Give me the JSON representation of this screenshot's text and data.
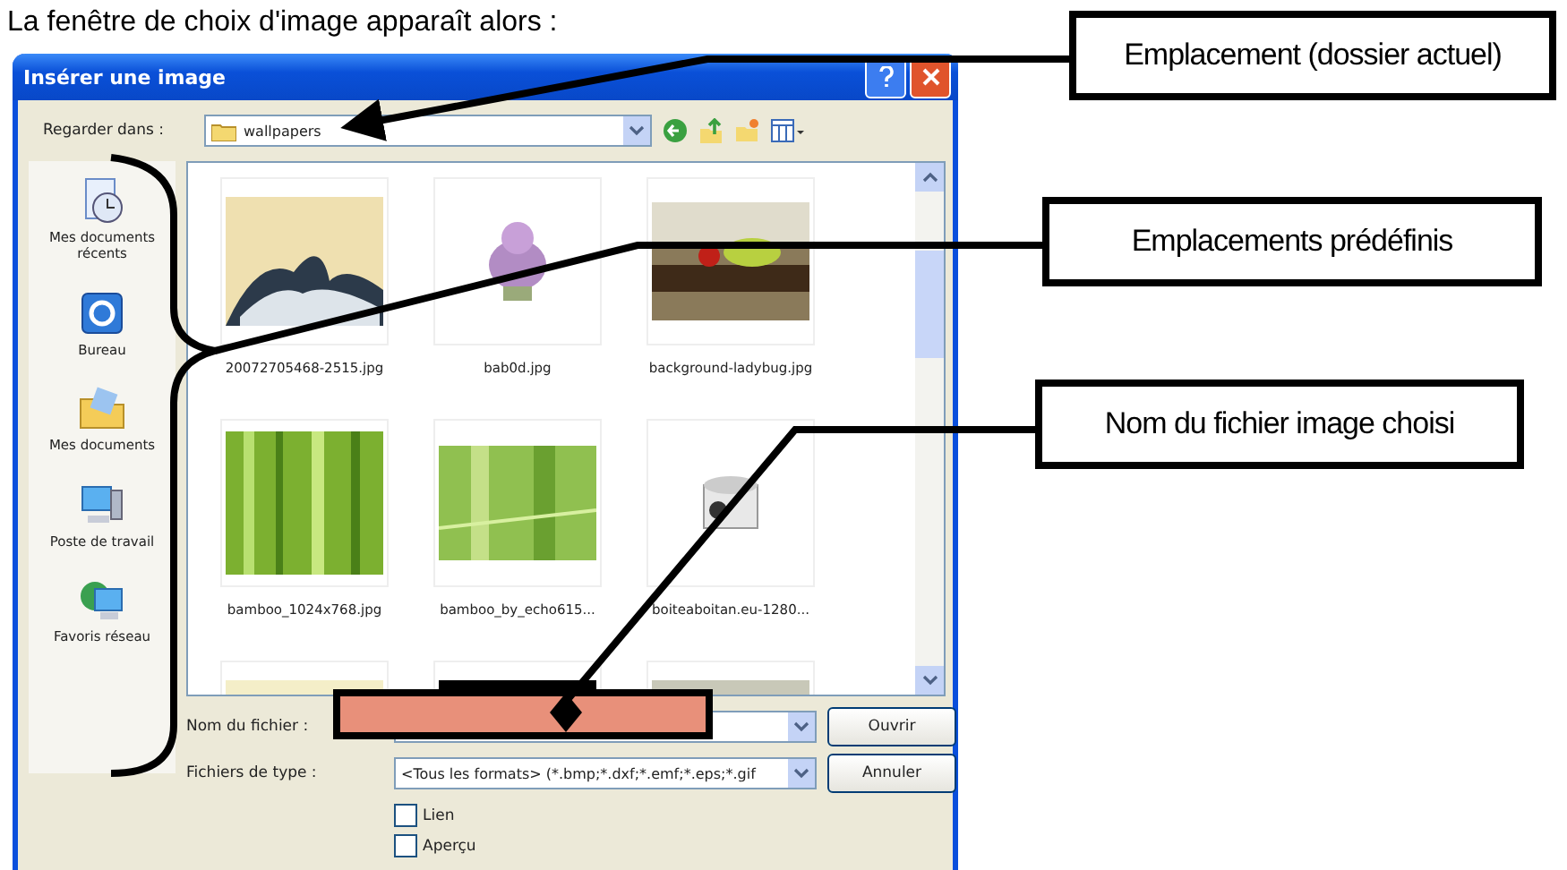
{
  "heading": "La fenêtre de choix d'image apparaît alors :",
  "dialog": {
    "title": "Insérer une image",
    "look_in": {
      "label": "Regarder dans :",
      "value": "wallpapers"
    },
    "places": [
      {
        "label": "Mes documents récents",
        "kind": "recent"
      },
      {
        "label": "Bureau",
        "kind": "desktop"
      },
      {
        "label": "Mes documents",
        "kind": "documents"
      },
      {
        "label": "Poste de travail",
        "kind": "computer"
      },
      {
        "label": "Favoris réseau",
        "kind": "network"
      }
    ],
    "files": [
      {
        "kind": "file",
        "name": "20072705468-2515.jpg"
      },
      {
        "kind": "file",
        "name": "bab0d.jpg"
      },
      {
        "kind": "file",
        "name": "background-ladybug.jpg"
      },
      {
        "kind": "file",
        "name": "bamboo_1024x768.jpg"
      },
      {
        "kind": "file",
        "name": "bamboo_by_echo615..."
      },
      {
        "kind": "file",
        "name": "boiteaboitan.eu-1280..."
      },
      {
        "kind": "picture"
      },
      {
        "kind": "picture"
      },
      {
        "kind": "picture"
      }
    ],
    "file_name": {
      "label": "Nom du fichier :"
    },
    "file_type": {
      "label": "Fichiers de type :",
      "value": "<Tous les formats> (*.bmp;*.dxf;*.emf;*.eps;*.gif"
    },
    "buttons": [
      "Ouvrir",
      "Annuler"
    ],
    "options": [
      {
        "label": "Lien",
        "checked": false
      },
      {
        "label": "Aperçu",
        "checked": false
      }
    ]
  },
  "callouts": [
    "Emplacement (dossier actuel)",
    "Emplacements prédéfinis",
    "Nom du fichier image choisi"
  ]
}
